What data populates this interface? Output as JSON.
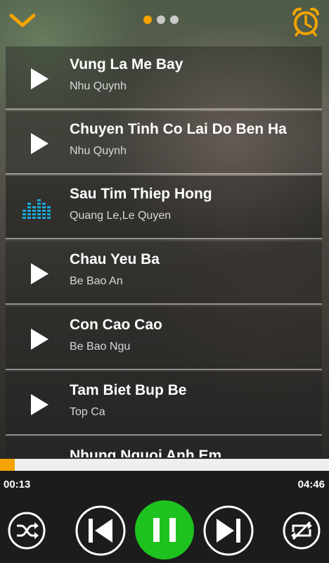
{
  "header": {
    "pager_total": 3,
    "pager_active": 0,
    "accent_color": "#f4a300"
  },
  "songs": [
    {
      "title": "Vung La Me Bay",
      "artist": "Nhu Quynh",
      "state": "idle"
    },
    {
      "title": "Chuyen Tinh Co Lai Do Ben Ha",
      "artist": "Nhu Quynh",
      "state": "idle"
    },
    {
      "title": "Sau Tim Thiep Hong",
      "artist": "Quang Le,Le Quyen",
      "state": "playing"
    },
    {
      "title": "Chau Yeu Ba",
      "artist": "Be Bao An",
      "state": "idle"
    },
    {
      "title": "Con Cao Cao",
      "artist": "Be Bao Ngu",
      "state": "idle"
    },
    {
      "title": "Tam Biet Bup Be",
      "artist": "Top Ca",
      "state": "idle"
    },
    {
      "title": "Nhung Nguoi Anh Em",
      "artist": "",
      "state": "idle"
    }
  ],
  "player": {
    "current_time": "00:13",
    "total_time": "04:46",
    "progress": 0.045,
    "play_button_color": "#1ec21e",
    "eq_color": "#1aa7d6"
  },
  "icons": {
    "collapse": "chevron-down-icon",
    "alarm": "alarm-clock-icon",
    "shuffle": "shuffle-icon",
    "previous": "skip-previous-icon",
    "pause": "pause-icon",
    "next": "skip-next-icon",
    "repeat": "repeat-off-icon",
    "row_play": "play-icon",
    "row_eq": "equalizer-icon"
  }
}
